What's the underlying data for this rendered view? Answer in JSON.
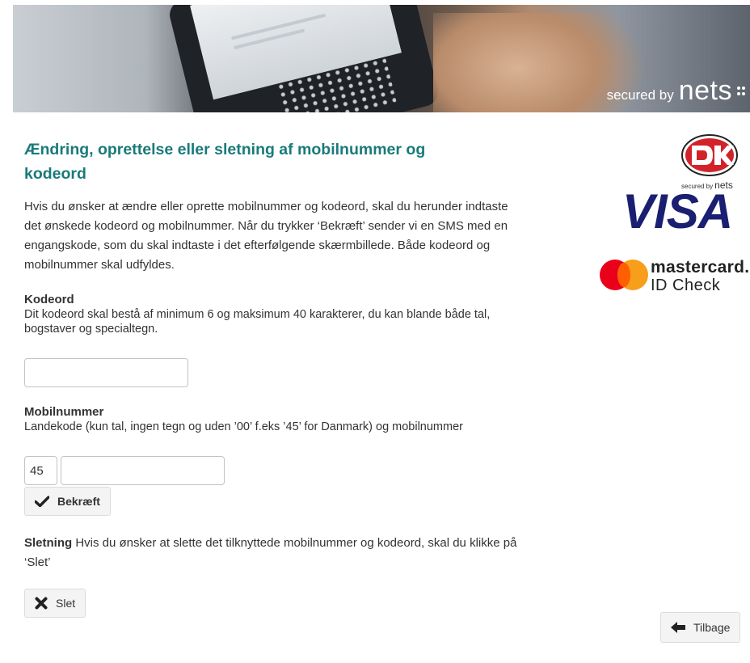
{
  "banner": {
    "secured_prefix": "secured by",
    "secured_brand": "nets"
  },
  "title": "Ændring, oprettelse eller sletning af mobilnummer og kodeord",
  "intro": "Hvis du ønsker at ændre eller oprette mobilnummer og kodeord, skal du herunder indtaste det ønskede kodeord og mobilnummer. Når du trykker ‘Bekræft’ sender vi en SMS med en engangskode, som du skal indtaste i det efterfølgende skærmbillede. Både kodeord og mobilnummer skal udfyldes.",
  "password": {
    "heading": "Kodeord",
    "help": "Dit kodeord skal bestå af minimum 6 og maksimum 40 karakterer, du kan blande både tal, bogstaver og specialtegn.",
    "value": ""
  },
  "mobile": {
    "heading": "Mobilnummer",
    "help": "Landekode (kun tal, ingen tegn og uden ’00’ f.eks ’45’ for Danmark) og mobilnummer",
    "country_code": "45",
    "number": ""
  },
  "confirm_button": {
    "label": "Bekræft",
    "icon": "check-icon"
  },
  "delete": {
    "heading": "Sletning",
    "text": " Hvis du ønsker at slette det tilknyttede mobilnummer og kodeord, skal du klikke på ‘Slet’",
    "button_label": "Slet",
    "icon": "x-icon"
  },
  "back_button": {
    "label": "Tilbage",
    "icon": "arrow-left-icon"
  },
  "logos": {
    "dk_secured_prefix": "secured by",
    "dk_secured_brand": "nets",
    "visa": "VISA",
    "mastercard_name": "mastercard.",
    "mastercard_sub": "ID Check"
  },
  "colors": {
    "title": "#1a7a7a",
    "visa": "#1a1f71",
    "mc_red": "#eb001b",
    "mc_yellow": "#f79e1b",
    "dk_red": "#d2232a"
  }
}
